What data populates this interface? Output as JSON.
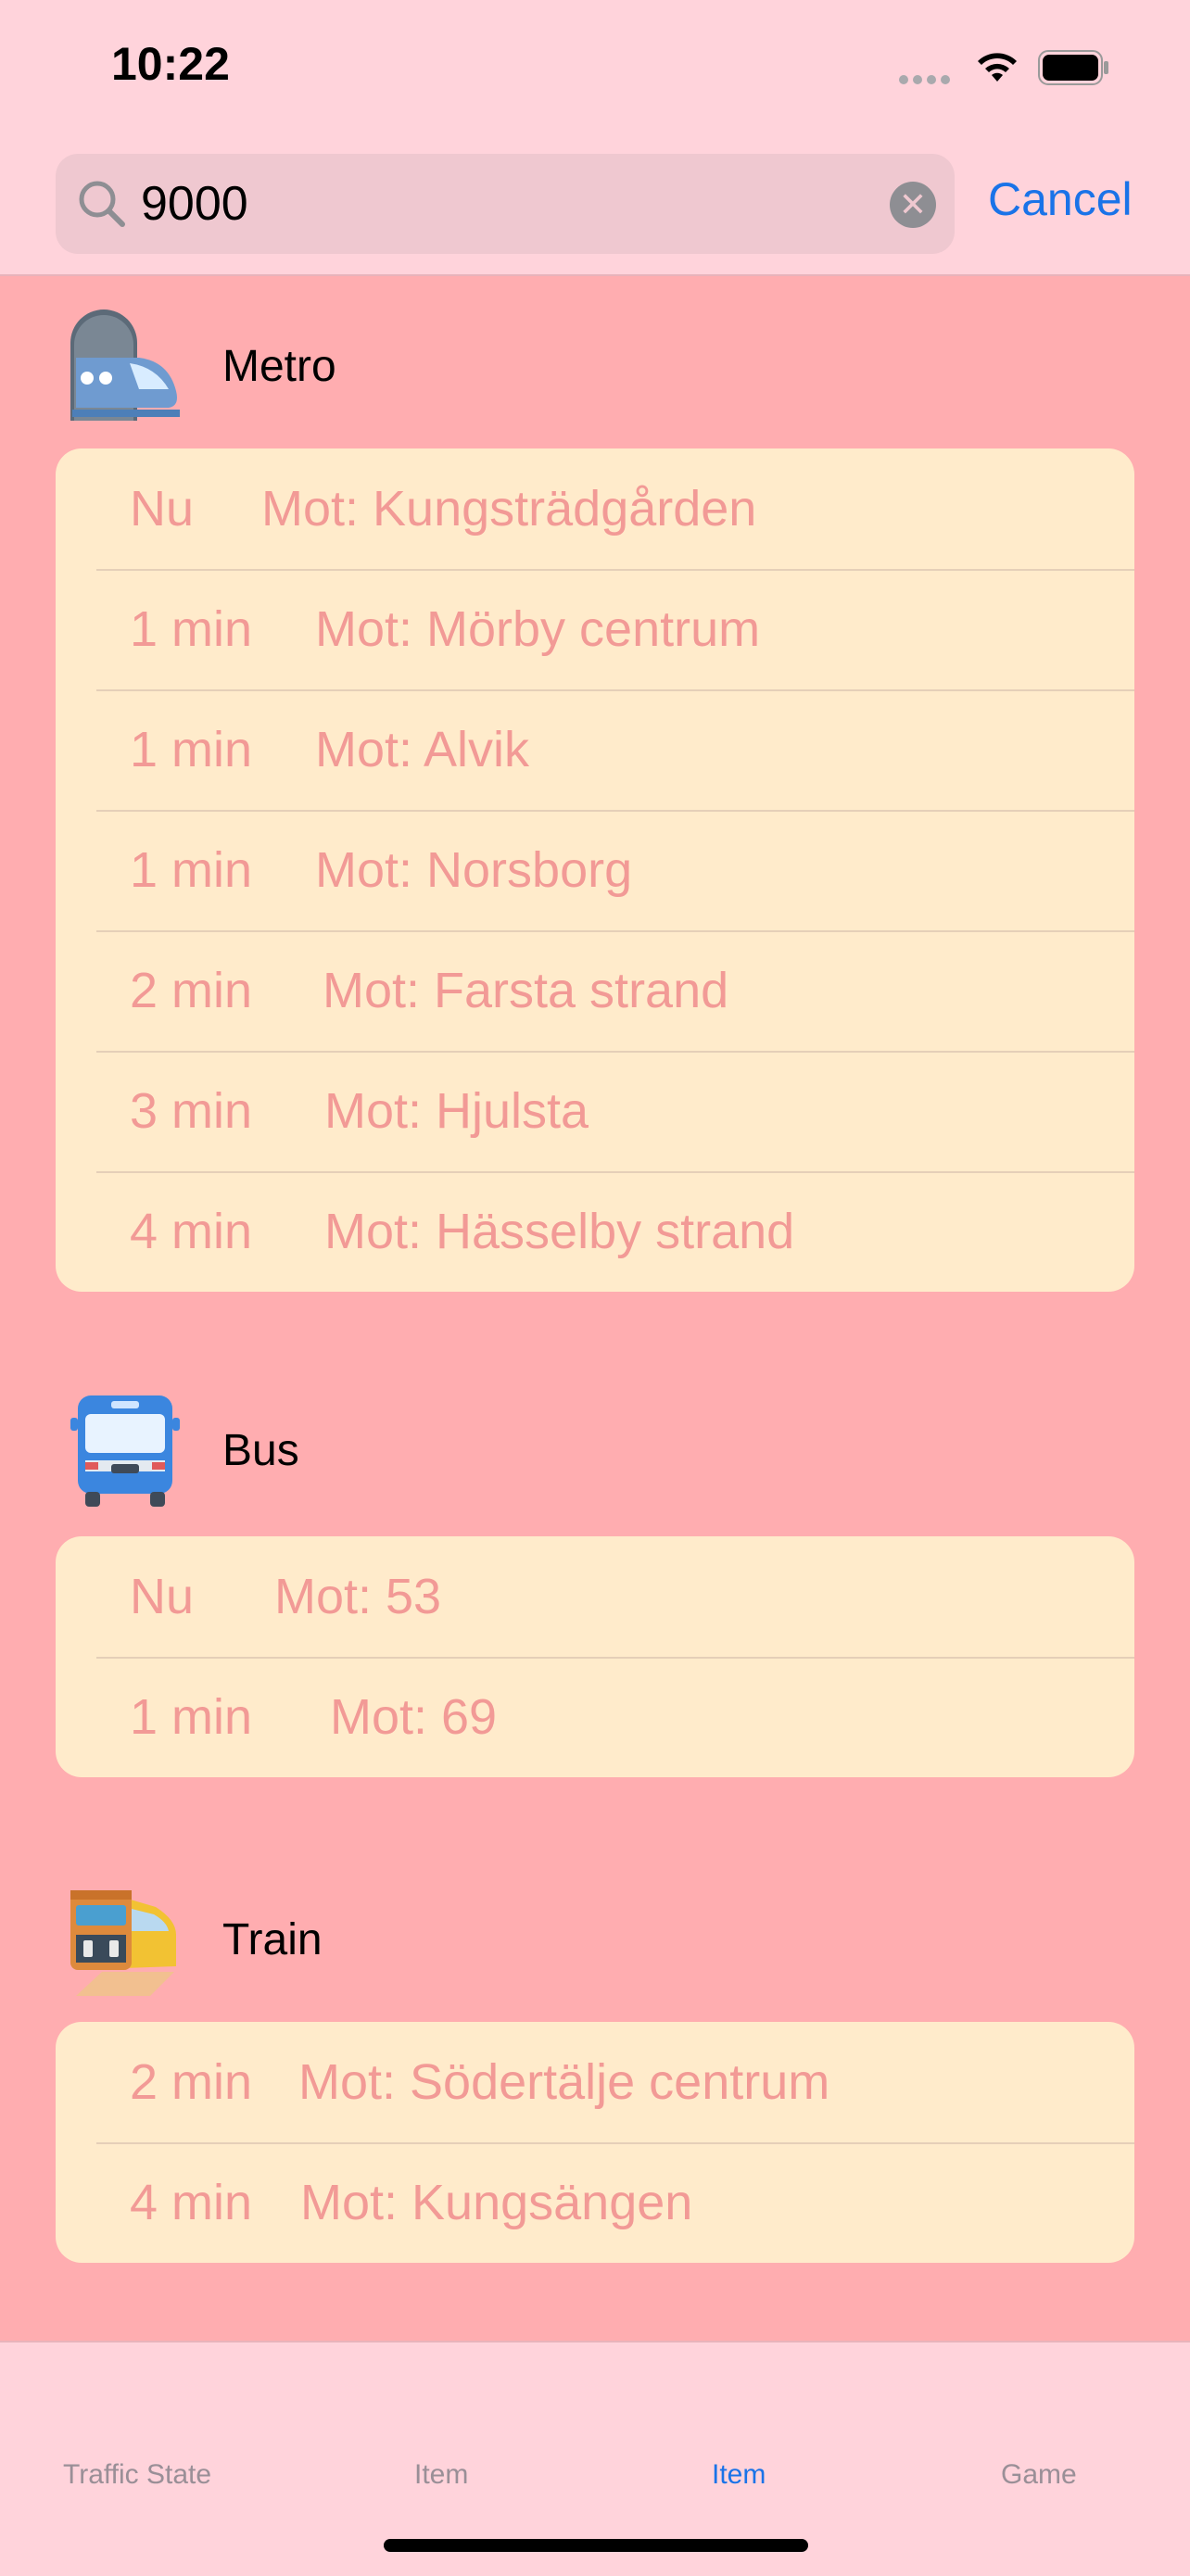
{
  "status_bar": {
    "time": "10:22",
    "icons": [
      "signal-icon",
      "wifi-icon",
      "battery-icon"
    ]
  },
  "search": {
    "value": "9000",
    "cancel_label": "Cancel"
  },
  "sections": [
    {
      "title": "Metro",
      "icon": "metro-train-icon",
      "departures": [
        {
          "time": "Nu",
          "destination": "Mot: Kungsträdgården"
        },
        {
          "time": "1 min",
          "destination": "Mot: Mörby centrum"
        },
        {
          "time": "1 min",
          "destination": "Mot: Alvik"
        },
        {
          "time": "1 min",
          "destination": "Mot: Norsborg"
        },
        {
          "time": "2 min",
          "destination": "Mot: Farsta strand"
        },
        {
          "time": "3 min",
          "destination": "Mot: Hjulsta"
        },
        {
          "time": "4 min",
          "destination": "Mot: Hässelby strand"
        }
      ]
    },
    {
      "title": "Bus",
      "icon": "bus-icon",
      "departures": [
        {
          "time": "Nu",
          "destination": "Mot: 53"
        },
        {
          "time": "1 min",
          "destination": "Mot: 69"
        }
      ]
    },
    {
      "title": "Train",
      "icon": "train-icon",
      "departures": [
        {
          "time": "2 min",
          "destination": "Mot: Södertälje centrum"
        },
        {
          "time": "4 min",
          "destination": "Mot: Kungsängen"
        }
      ]
    }
  ],
  "tabs": [
    {
      "label": "Traffic State",
      "active": false
    },
    {
      "label": "Item",
      "active": false
    },
    {
      "label": "Item",
      "active": true
    },
    {
      "label": "Game",
      "active": false
    }
  ],
  "colors": {
    "background": "#ffadb0",
    "bar_background": "#ffd3db",
    "card_background": "#ffebcb",
    "departure_text": "#f29a96",
    "accent": "#1a73e8"
  }
}
